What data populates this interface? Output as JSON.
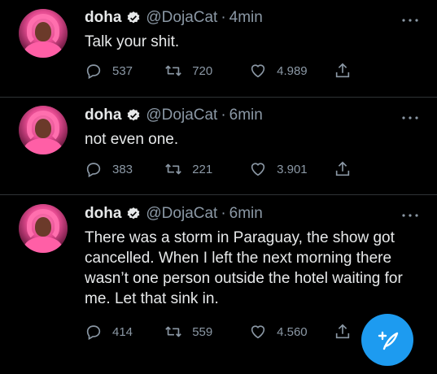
{
  "tweets": [
    {
      "name": "doha",
      "handle": "@DojaCat",
      "time": "4min",
      "text": "Talk your shit.",
      "replies": "537",
      "retweets": "720",
      "likes": "4.989"
    },
    {
      "name": "doha",
      "handle": "@DojaCat",
      "time": "6min",
      "text": "not even one.",
      "replies": "383",
      "retweets": "221",
      "likes": "3.901"
    },
    {
      "name": "doha",
      "handle": "@DojaCat",
      "time": "6min",
      "text": "There was a storm in Paraguay, the show got cancelled. When I left the next morning there wasn’t one person outside the hotel waiting for me. Let that sink in.",
      "replies": "414",
      "retweets": "559",
      "likes": "4.560"
    }
  ],
  "separator": "·",
  "colors": {
    "accent": "#1d9bf0",
    "muted": "#8b98a5",
    "text": "#e7e9ea",
    "background": "#000000"
  },
  "icons": [
    "verified-badge-icon",
    "more-icon",
    "reply-icon",
    "retweet-icon",
    "like-icon",
    "share-icon",
    "compose-icon"
  ]
}
